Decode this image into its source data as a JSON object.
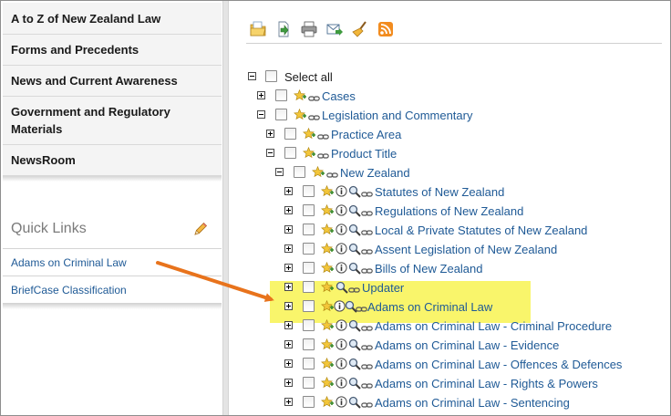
{
  "sidebar": {
    "nav": [
      {
        "label": "A to Z of New Zealand Law"
      },
      {
        "label": "Forms and Precedents"
      },
      {
        "label": "News and Current Awareness"
      },
      {
        "label": "Government and Regulatory Materials"
      },
      {
        "label": "NewsRoom"
      }
    ],
    "quick_links": {
      "title": "Quick Links",
      "items": [
        {
          "label": "Adams on Criminal Law"
        },
        {
          "label": "BriefCase Classification"
        }
      ]
    }
  },
  "toolbar": {
    "icons": [
      "open-folder-icon",
      "export-document-icon",
      "print-icon",
      "email-icon",
      "clear-broom-icon",
      "rss-feed-icon"
    ]
  },
  "tree": {
    "select_all": "Select all",
    "nodes": [
      {
        "label": "Cases"
      },
      {
        "label": "Legislation and Commentary"
      },
      {
        "label": "Practice Area"
      },
      {
        "label": "Product Title"
      },
      {
        "label": "New Zealand"
      },
      {
        "label": "Statutes of New Zealand"
      },
      {
        "label": "Regulations of New Zealand"
      },
      {
        "label": "Local & Private Statutes of New Zealand"
      },
      {
        "label": "Assent Legislation of New Zealand"
      },
      {
        "label": "Bills of New Zealand"
      },
      {
        "label": "Updater"
      },
      {
        "label": "Adams on Criminal Law"
      },
      {
        "label": "Adams on Criminal Law - Criminal Procedure"
      },
      {
        "label": "Adams on Criminal Law - Evidence"
      },
      {
        "label": "Adams on Criminal Law - Offences & Defences"
      },
      {
        "label": "Adams on Criminal Law - Rights & Powers"
      },
      {
        "label": "Adams on Criminal Law - Sentencing"
      }
    ]
  },
  "colors": {
    "link": "#1f5a96",
    "highlight": "#f9f56b",
    "arrow": "#e8731c"
  }
}
